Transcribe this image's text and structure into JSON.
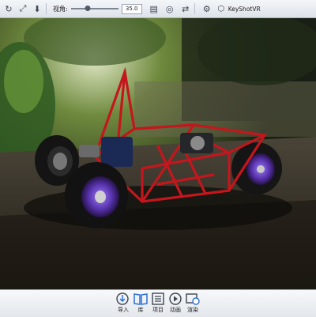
{
  "toolbar": {
    "fov_label": "视角:",
    "fov_value": "35.0",
    "fov_level": 0.35,
    "vr_label": "KeyShotVR",
    "icons": [
      "reset-view-icon",
      "fit-view-icon",
      "download-icon",
      "render-region-icon",
      "environment-icon",
      "swap-icon",
      "settings-icon",
      "keyshot-vr-icon"
    ]
  },
  "viewport": {
    "subject": "red tube-frame go-kart rendered outdoors in a forest clearing"
  },
  "bottom": {
    "import_label": "导入",
    "library_label": "库",
    "project_label": "项目",
    "animation_label": "动画",
    "render_label": "渲染"
  },
  "colors": {
    "frame_red": "#c4161c",
    "rim_purple": "#6a3fc8",
    "accent_blue": "#2a6fd6"
  }
}
